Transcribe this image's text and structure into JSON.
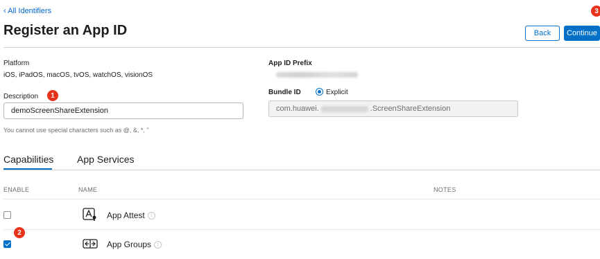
{
  "nav": {
    "back_link": "‹ All Identifiers"
  },
  "header": {
    "title": "Register an App ID",
    "back_button": "Back",
    "continue_button": "Continue"
  },
  "annotations": {
    "badge_1": "1",
    "badge_2": "2",
    "badge_3": "3"
  },
  "form": {
    "platform_label": "Platform",
    "platform_value": "iOS, iPadOS, macOS, tvOS, watchOS, visionOS",
    "prefix_label": "App ID Prefix",
    "description_label": "Description",
    "description_value": "demoScreenShareExtension",
    "description_hint": "You cannot use special characters such as @, &, *, \"",
    "bundle_label": "Bundle ID",
    "bundle_type": "Explicit",
    "bundle_prefix": "com.huawei.",
    "bundle_suffix": ".ScreenShareExtension"
  },
  "tabs": [
    {
      "label": "Capabilities",
      "active": true
    },
    {
      "label": "App Services",
      "active": false
    }
  ],
  "table": {
    "headers": {
      "enable": "ENABLE",
      "name": "NAME",
      "notes": "NOTES"
    },
    "rows": [
      {
        "name": "App Attest",
        "enabled": false,
        "icon": "app-attest-icon"
      },
      {
        "name": "App Groups",
        "enabled": true,
        "icon": "app-groups-icon"
      }
    ]
  },
  "colors": {
    "accent": "#0070c9",
    "link": "#0066cc",
    "badge": "#e8321b"
  }
}
